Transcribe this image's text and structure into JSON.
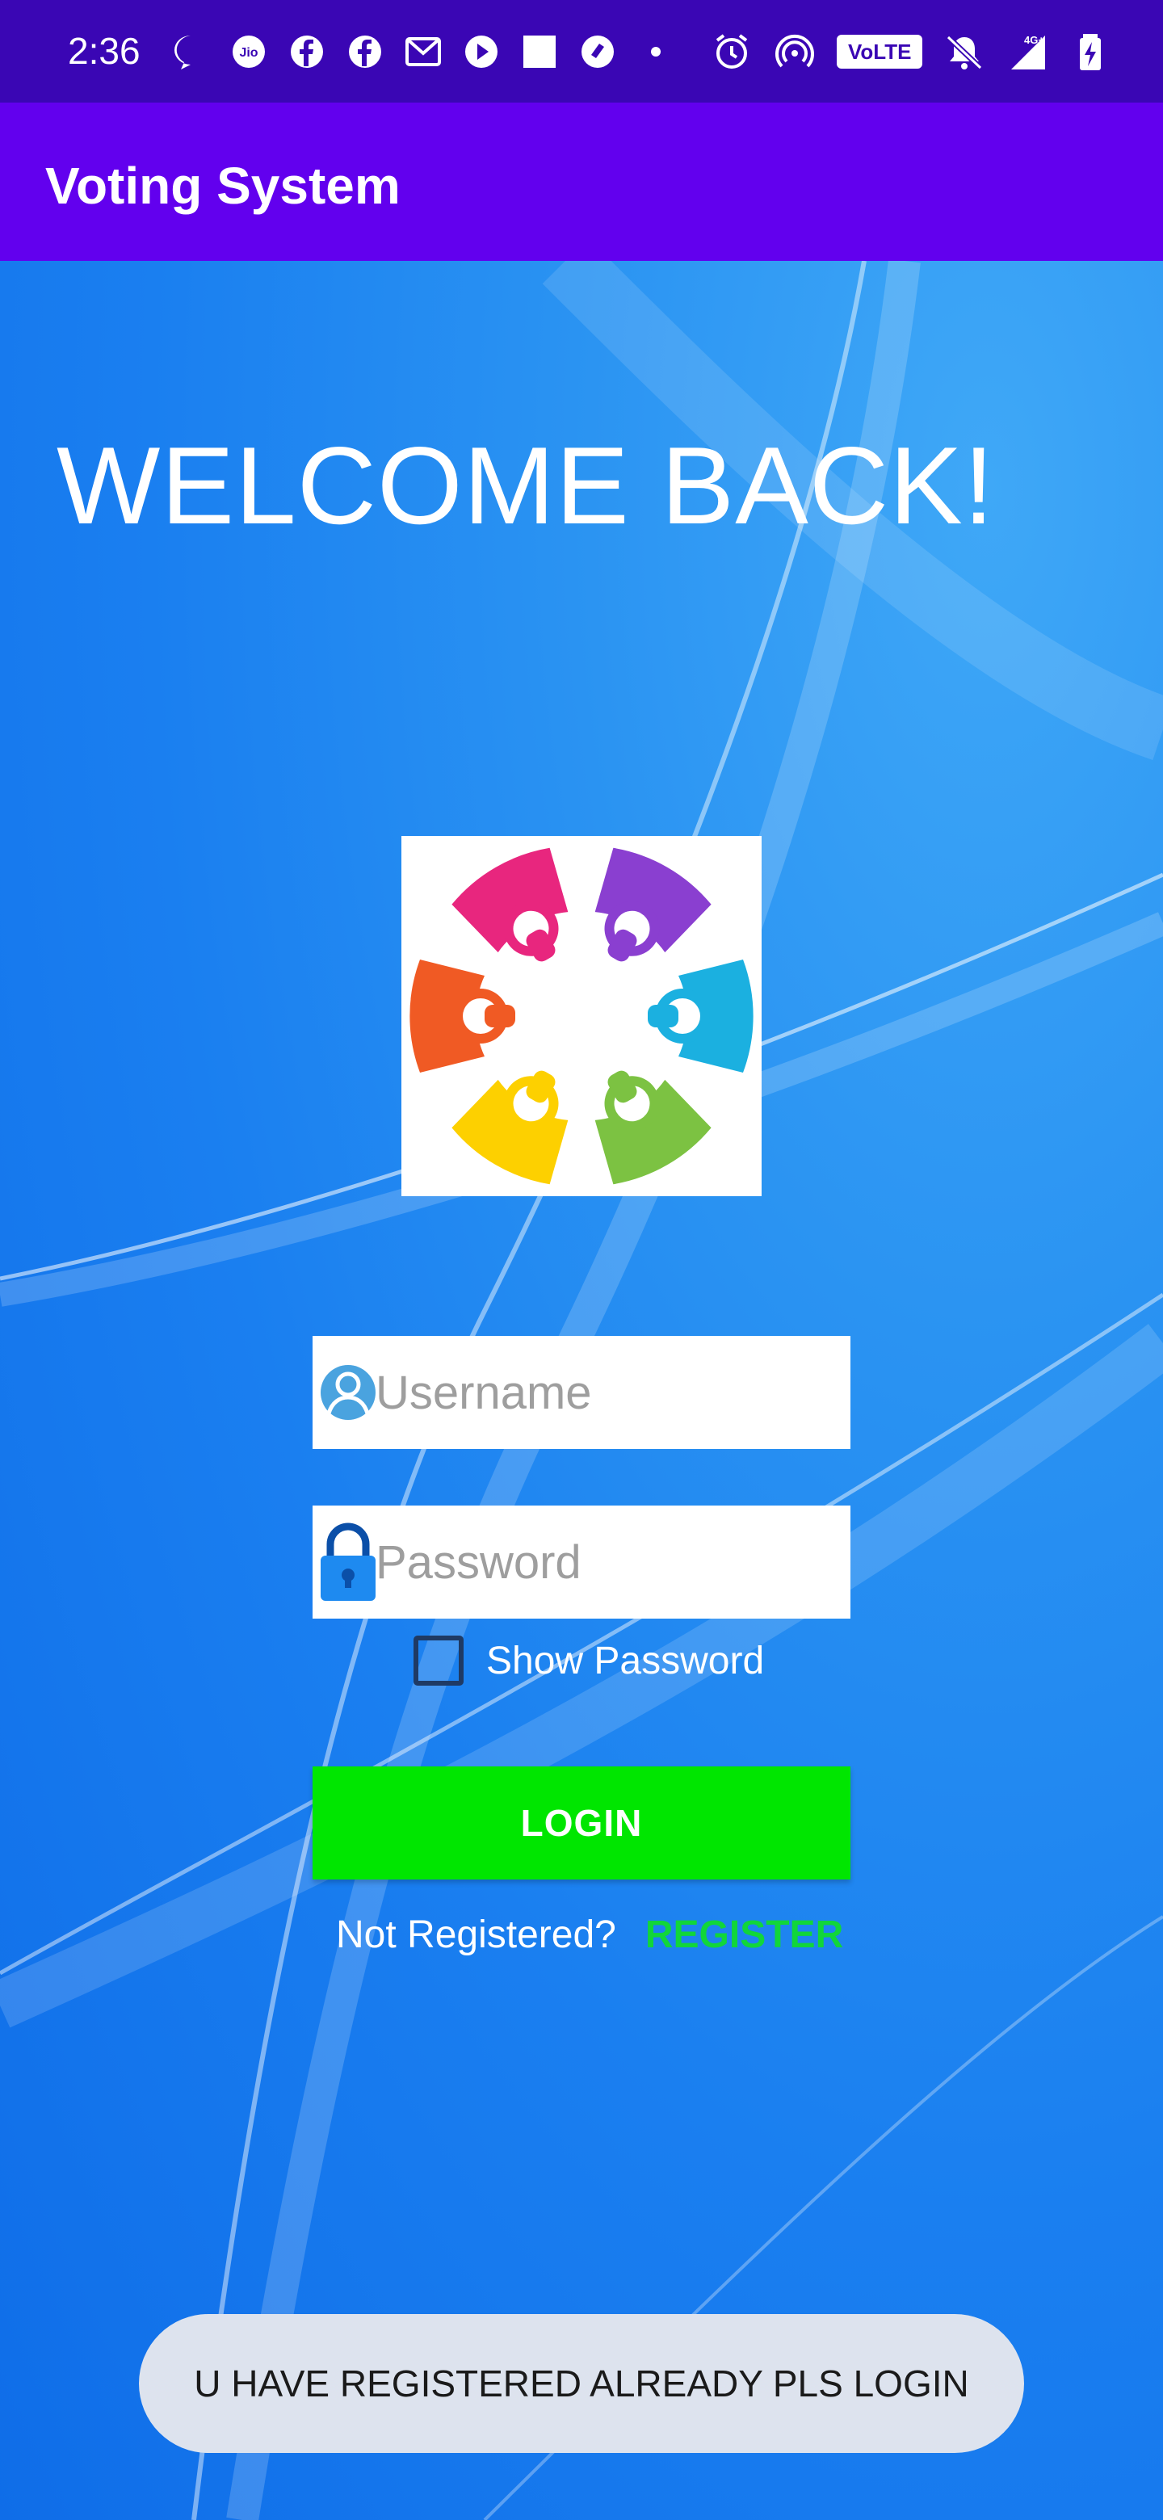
{
  "status_bar": {
    "time": "2:36",
    "left_icons": [
      "message-icon",
      "jio-icon",
      "facebook-icon",
      "facebook-icon",
      "gmail-icon",
      "play-icon",
      "square-icon",
      "app-icon",
      "dot-icon"
    ],
    "right_icons": [
      "alarm-icon",
      "hotspot-icon",
      "volte-badge",
      "mute-icon",
      "signal-4g-icon",
      "battery-charging-icon"
    ],
    "volte_label": "VoLTE",
    "network_label": "4G+"
  },
  "app_bar": {
    "title": "Voting System"
  },
  "welcome": "WELCOME BACK!",
  "form": {
    "username_placeholder": "Username",
    "password_placeholder": "Password",
    "show_password_label": "Show Password",
    "login_label": "LOGIN",
    "not_registered_text": "Not Registered?",
    "register_label": "REGISTER"
  },
  "toast": "U HAVE REGISTERED ALREADY PLS LOGIN",
  "colors": {
    "status_bar": "#3a06b4",
    "app_bar": "#6200ee",
    "background": "#1a7ff0",
    "login_button": "#00e600",
    "register_link": "#11d63a",
    "toast_bg": "#dde3ee"
  }
}
